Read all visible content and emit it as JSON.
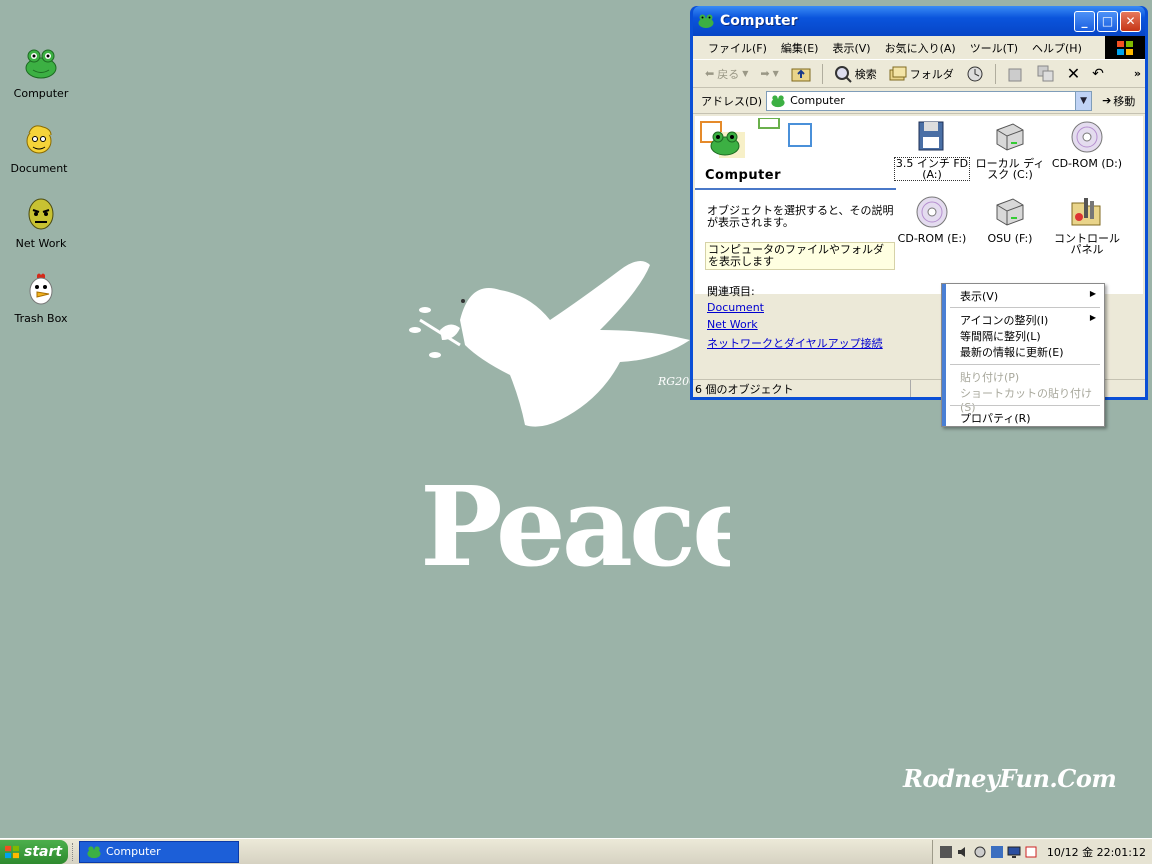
{
  "desktop": {
    "icons": [
      {
        "label": "Computer"
      },
      {
        "label": "Document"
      },
      {
        "label": "Net Work"
      },
      {
        "label": "Trash Box"
      }
    ],
    "wallpaper": {
      "text": "Peace",
      "signature": "RG200",
      "brand": "RodneyFun.Com"
    }
  },
  "window": {
    "title": "Computer",
    "menus": [
      "ファイル(F)",
      "編集(E)",
      "表示(V)",
      "お気に入り(A)",
      "ツール(T)",
      "ヘルプ(H)"
    ],
    "toolbar": {
      "back": "戻る",
      "search": "検索",
      "folders": "フォルダ",
      "overflow": "»"
    },
    "address": {
      "label": "アドレス(D)",
      "value": "Computer",
      "go": "移動"
    },
    "taskpane": {
      "heading": "Computer",
      "description": "オブジェクトを選択すると、その説明が表示されます。",
      "tip": "コンピュータのファイルやフォルダを表示します",
      "related_title": "関連項目:",
      "links": [
        "Document",
        "Net Work",
        "ネットワークとダイヤルアップ接続"
      ]
    },
    "drives": [
      {
        "label": "3.5 インチ FD (A:)"
      },
      {
        "label": "ローカル ディスク (C:)"
      },
      {
        "label": "CD-ROM (D:)"
      },
      {
        "label": "CD-ROM (E:)"
      },
      {
        "label": "OSU (F:)"
      },
      {
        "label": "コントロール パネル"
      }
    ],
    "status": "6 個のオブジェクト"
  },
  "context_menu": {
    "items": [
      {
        "label": "表示(V)",
        "submenu": true,
        "disabled": false
      },
      {
        "label": "アイコンの整列(I)",
        "submenu": true,
        "disabled": false
      },
      {
        "label": "等間隔に整列(L)",
        "submenu": false,
        "disabled": false
      },
      {
        "label": "最新の情報に更新(E)",
        "submenu": false,
        "disabled": false
      },
      {
        "label": "貼り付け(P)",
        "submenu": false,
        "disabled": true
      },
      {
        "label": "ショートカットの貼り付け(S)",
        "submenu": false,
        "disabled": true
      },
      {
        "label": "プロパティ(R)",
        "submenu": false,
        "disabled": false
      }
    ]
  },
  "taskbar": {
    "start_label": "start",
    "task_button": "Computer",
    "clock": "10/12 金 22:01:12"
  },
  "colors": {
    "desktop_bg": "#9bb3a8",
    "titlebar": "#0a54dc",
    "menu_bar_accent": "#4a7fd4",
    "link": "#0000d0"
  }
}
